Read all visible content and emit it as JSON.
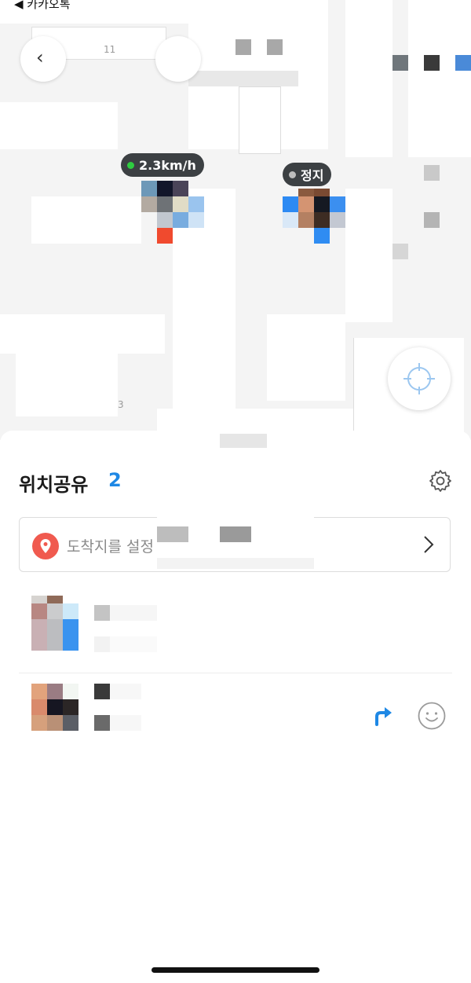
{
  "status_bar": {
    "back_app_label": "◀ 카카오톡"
  },
  "map": {
    "address_numbers": [
      "11",
      "3"
    ],
    "chips": [
      {
        "label": "2.3km/h",
        "dot_color": "#2ecc40"
      },
      {
        "label": "정지",
        "dot_color": "#bdbdbd"
      }
    ],
    "locate_icon": "crosshair-icon"
  },
  "sheet": {
    "title": "위치공유",
    "count": "2",
    "settings_icon": "gear-icon",
    "destination": {
      "placeholder": "도착지를 설정",
      "pin_icon": "location-pin-icon",
      "arrow_icon": "chevron-right-icon"
    },
    "members_actions": {
      "navigate_icon": "turn-arrow-icon",
      "emoji_icon": "smiley-icon"
    }
  },
  "colors": {
    "accent_blue": "#1e88e5",
    "pin_red": "#f05a4f",
    "chip_bg": "#3c4043",
    "moving_dot": "#2ecc40"
  }
}
